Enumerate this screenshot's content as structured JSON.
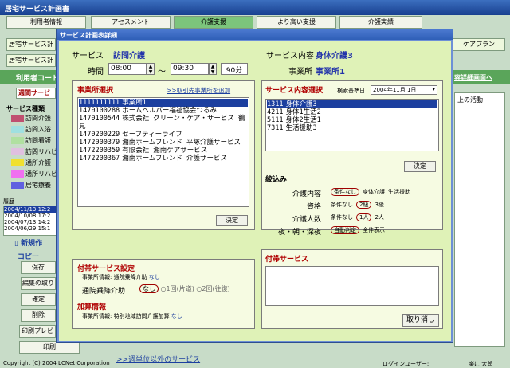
{
  "app": {
    "title": "居宅サービス計画書"
  },
  "top_buttons": [
    {
      "label": "利用者情報"
    },
    {
      "label": "アセスメント"
    },
    {
      "label": "介護支援"
    },
    {
      "label": "より高い支援"
    },
    {
      "label": "介護実績"
    }
  ],
  "second_tabs": [
    {
      "label": "居宅サービス計"
    },
    {
      "label": "居宅サービス計"
    },
    {
      "label": "ケアプラン"
    }
  ],
  "left": {
    "user_code": "利用者コード",
    "weekly": "週間サービ",
    "service_kind": "サービス種類",
    "items": [
      {
        "label": "訪問介護",
        "color": "#c05070"
      },
      {
        "label": "訪問入浴",
        "color": "#a0e0e0"
      },
      {
        "label": "訪問看護",
        "color": "#b0e0a0"
      },
      {
        "label": "訪問リハビ",
        "color": "#e0c0e0"
      },
      {
        "label": "通所介護",
        "color": "#f0e030"
      },
      {
        "label": "通所リハビ",
        "color": "#f070f0"
      },
      {
        "label": "居宅療養",
        "color": "#6060e0"
      }
    ],
    "history_label": "履歴",
    "history": [
      "2004/11/13 12:2",
      "2004/10/08 17:2",
      "2004/07/13 14:2",
      "2004/06/29 15:1"
    ],
    "new_label": "新規作",
    "copy_label": "コピー",
    "buttons": [
      "保存",
      "編集の取り",
      "確定",
      "削除",
      "印刷プレビ",
      "印刷"
    ]
  },
  "right": {
    "link": "容詳細画面へ",
    "col_header": "上の活動"
  },
  "footer": {
    "copyright": "Copyright (C) 2004 LCNet Corporation",
    "login_label": "ログインユーザー:",
    "user": "楽に 太郎",
    "other_services": ">>週単位以外のサービス"
  },
  "dialog": {
    "title": "サービス計画表詳細",
    "service_label": "サービス",
    "service_value": "訪問介護",
    "content_label": "サービス内容",
    "content_value": "身体介護3",
    "time_label": "時間",
    "start": "08:00",
    "end": "09:30",
    "tilde": "〜",
    "duration": "90分",
    "office_label": "事業所",
    "office_value": "事業所1",
    "office_select": {
      "title": "事業所選択",
      "link": ">>取引先事業所を追加",
      "items": [
        {
          "code": "1111111111",
          "name": "事業所1"
        },
        {
          "code": "1470100288",
          "name": "ホームヘルパー福祉協会つるみ"
        },
        {
          "code": "1470100544",
          "name": "株式会社 グリーン・ケア・サービス 鶴見"
        },
        {
          "code": "1470200229",
          "name": "セーフティーライフ"
        },
        {
          "code": "1472000379",
          "name": "湘南ホームフレンド 平塚介護サービス"
        },
        {
          "code": "1472200359",
          "name": "有限会社 湘南ケアサービス"
        },
        {
          "code": "1472200367",
          "name": "湘南ホームフレンド 介護サービス"
        }
      ],
      "ok": "決定"
    },
    "content_select": {
      "title": "サービス内容選択",
      "search_label": "検索基準日",
      "search_date": "2004年11月 1日",
      "items": [
        {
          "code": "1311",
          "name": "身体介護3"
        },
        {
          "code": "4211",
          "name": "身体1生活2"
        },
        {
          "code": "5111",
          "name": "身体2生活1"
        },
        {
          "code": "7311",
          "name": "生活援助3"
        }
      ],
      "ok": "決定"
    },
    "filter": {
      "title": "絞込み",
      "rows": [
        {
          "label": "介護内容",
          "opts": [
            "条件なし",
            "身体介護",
            "生活援助"
          ],
          "sel": 0
        },
        {
          "label": "資格",
          "opts": [
            "条件なし",
            "2級",
            "3級"
          ],
          "sel": 1
        },
        {
          "label": "介護人数",
          "opts": [
            "条件なし",
            "1人",
            "2人"
          ],
          "sel": 1
        },
        {
          "label": "夜・朝・深夜",
          "opts": [
            "自動判定",
            "全件表示"
          ],
          "sel": 0
        }
      ]
    },
    "extra": {
      "title": "付帯サービス設定",
      "info1": "事業所情報: 通院乗降介助",
      "info1_val": "なし",
      "ride_label": "通院乗降介助",
      "ride_opts": [
        "なし",
        "1回(片道)",
        "2回(往復)"
      ],
      "add_title": "加算情報",
      "info2": "事業所情報: 特別地域訪問介護加算",
      "info2_val": "なし"
    },
    "extra_service": {
      "title": "付帯サービス"
    },
    "cancel": "取り消し"
  }
}
